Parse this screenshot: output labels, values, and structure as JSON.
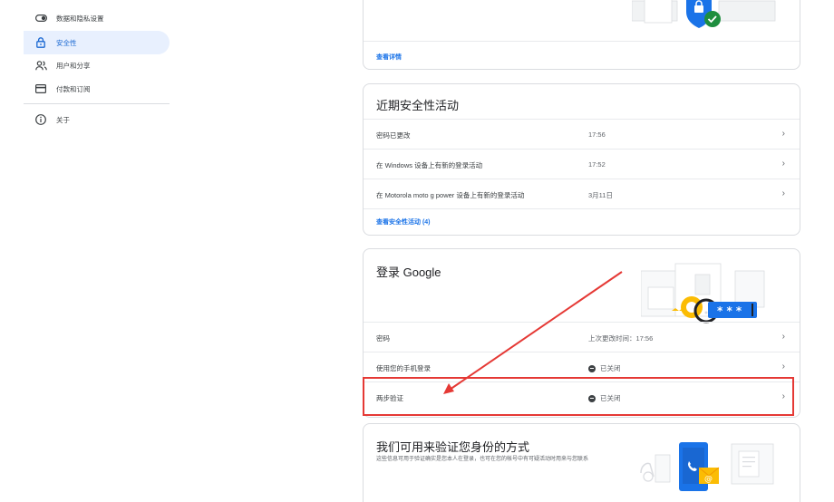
{
  "sidebar": {
    "items": [
      {
        "label": "数据和隐私设置",
        "icon": "toggle-icon"
      },
      {
        "label": "安全性",
        "icon": "lock-icon",
        "active": true
      },
      {
        "label": "用户和分享",
        "icon": "people-icon"
      },
      {
        "label": "付款和订阅",
        "icon": "credit-card-icon"
      },
      {
        "label": "关于",
        "icon": "info-icon"
      }
    ]
  },
  "top_card": {
    "link": "查看详情"
  },
  "activity_card": {
    "title": "近期安全性活动",
    "rows": [
      {
        "label": "密码已更改",
        "time": "17:56"
      },
      {
        "label": "在 Windows 设备上有新的登录活动",
        "time": "17:52"
      },
      {
        "label": "在 Motorola moto g power 设备上有新的登录活动",
        "time": "3月11日"
      }
    ],
    "link": "查看安全性活动 (4)"
  },
  "signin_card": {
    "title": "登录 Google",
    "rows": [
      {
        "label": "密码",
        "value": "上次更改时间：17:56"
      },
      {
        "label": "使用您的手机登录",
        "value": "已关闭"
      },
      {
        "label": "两步验证",
        "value": "已关闭"
      }
    ]
  },
  "verify_card": {
    "title": "我们可用来验证您身份的方式",
    "description": "这些信息可用于验证确实是您本人在登录，也可在您的帐号中有可疑活动时用来与您联系"
  },
  "colors": {
    "accent": "#1a73e8",
    "annotation": "#e53935"
  }
}
